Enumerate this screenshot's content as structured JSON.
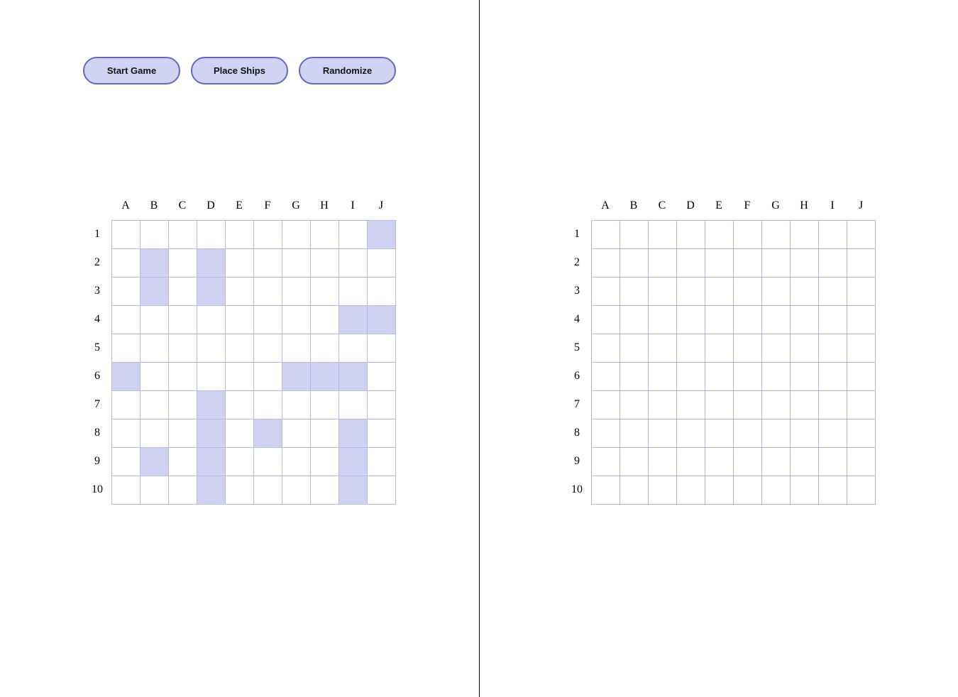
{
  "buttons": {
    "start_label": "Start Game",
    "place_label": "Place Ships",
    "randomize_label": "Randomize"
  },
  "columns": [
    "A",
    "B",
    "C",
    "D",
    "E",
    "F",
    "G",
    "H",
    "I",
    "J"
  ],
  "rows": [
    "1",
    "2",
    "3",
    "4",
    "5",
    "6",
    "7",
    "8",
    "9",
    "10"
  ],
  "colors": {
    "ship": "#d1d3f3",
    "button_border": "#6268c8",
    "grid_line": "#b8b9e2"
  },
  "player_board": {
    "ships": [
      "J1",
      "B2",
      "B3",
      "D2",
      "D3",
      "I4",
      "J4",
      "A6",
      "G6",
      "H6",
      "I6",
      "D7",
      "D8",
      "D9",
      "D10",
      "F8",
      "I8",
      "I9",
      "I10",
      "B9"
    ]
  },
  "opponent_board": {
    "ships": []
  }
}
